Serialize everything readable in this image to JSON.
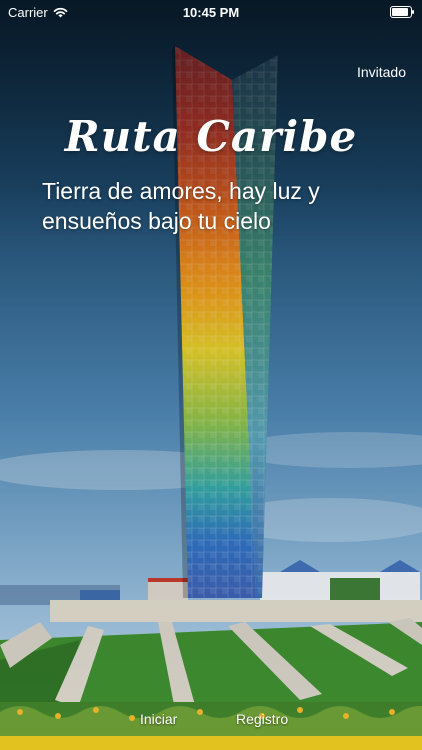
{
  "status_bar": {
    "carrier": "Carrier",
    "time": "10:45 PM",
    "wifi_icon": "wifi-icon",
    "battery_icon": "battery-icon"
  },
  "header": {
    "guest_label": "Invitado"
  },
  "hero": {
    "title": "Ruta Caribe",
    "tagline": "Tierra de amores, hay luz y ensueños bajo tu cielo",
    "image": "rainbow-tower-monument-photo"
  },
  "actions": {
    "login_label": "Iniciar",
    "register_label": "Registro"
  },
  "colors": {
    "sky_top": "#0f2f4a",
    "sky_mid": "#3f79a8",
    "sky_low": "#8cb4d4",
    "grass": "#3b8a2e",
    "text": "#ffffff"
  }
}
